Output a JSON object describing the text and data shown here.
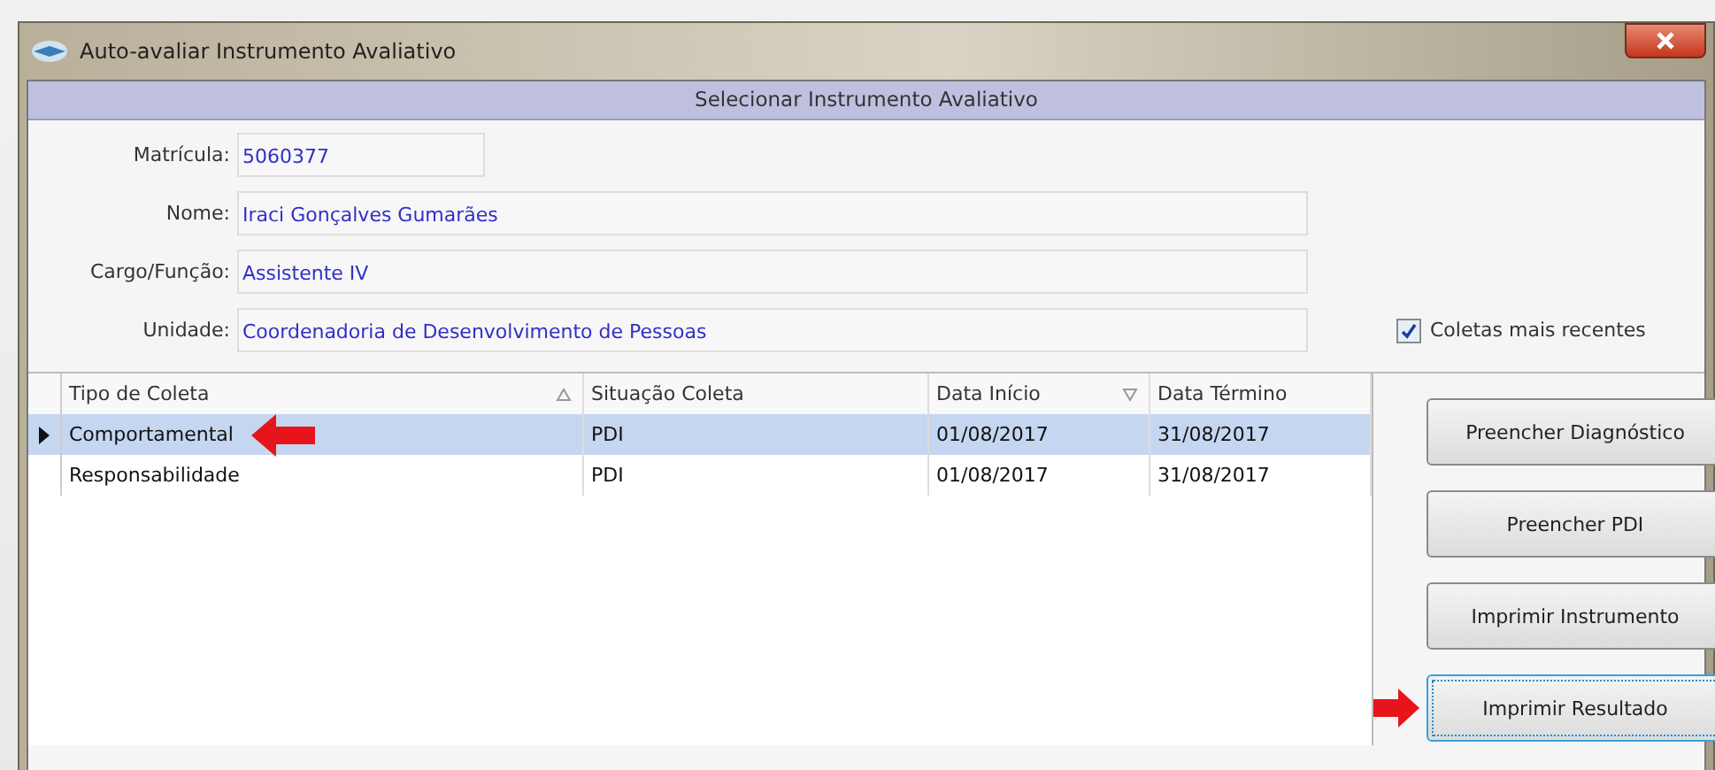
{
  "window": {
    "title": "Auto-avaliar Instrumento Avaliativo"
  },
  "header": "Selecionar Instrumento Avaliativo",
  "fields": [
    {
      "label": "Matrícula:",
      "value": "5060377",
      "kind": "short"
    },
    {
      "label": "Nome:",
      "value": "Iraci Gonçalves Gumarães",
      "kind": "long"
    },
    {
      "label": "Cargo/Função:",
      "value": "Assistente IV",
      "kind": "long"
    },
    {
      "label": "Unidade:",
      "value": "Coordenadoria de Desenvolvimento de Pessoas",
      "kind": "long"
    }
  ],
  "recent_checkbox": {
    "label": "Coletas mais recentes",
    "checked": true
  },
  "table": {
    "columns": [
      {
        "label": "Tipo de Coleta",
        "sorted_ascending": true,
        "sorted_descending": false
      },
      {
        "label": "Situação Coleta",
        "sorted_ascending": false,
        "sorted_descending": false
      },
      {
        "label": "Data Início",
        "sorted_ascending": false,
        "sorted_descending": true
      },
      {
        "label": "Data Término",
        "sorted_ascending": false,
        "sorted_descending": false
      }
    ],
    "rows": [
      {
        "cells": [
          "Comportamental",
          "PDI",
          "01/08/2017",
          "31/08/2017"
        ],
        "selected": true,
        "arrow": true
      },
      {
        "cells": [
          "Responsabilidade",
          "PDI",
          "01/08/2017",
          "31/08/2017"
        ],
        "selected": false,
        "arrow": false
      }
    ]
  },
  "buttons": [
    {
      "label": "Preencher Diagnóstico",
      "focused": false,
      "arrow": false
    },
    {
      "label": "Preencher PDI",
      "focused": false,
      "arrow": false
    },
    {
      "label": "Imprimir Instrumento",
      "focused": false,
      "arrow": false
    },
    {
      "label": "Imprimir Resultado",
      "focused": true,
      "arrow": true
    }
  ]
}
